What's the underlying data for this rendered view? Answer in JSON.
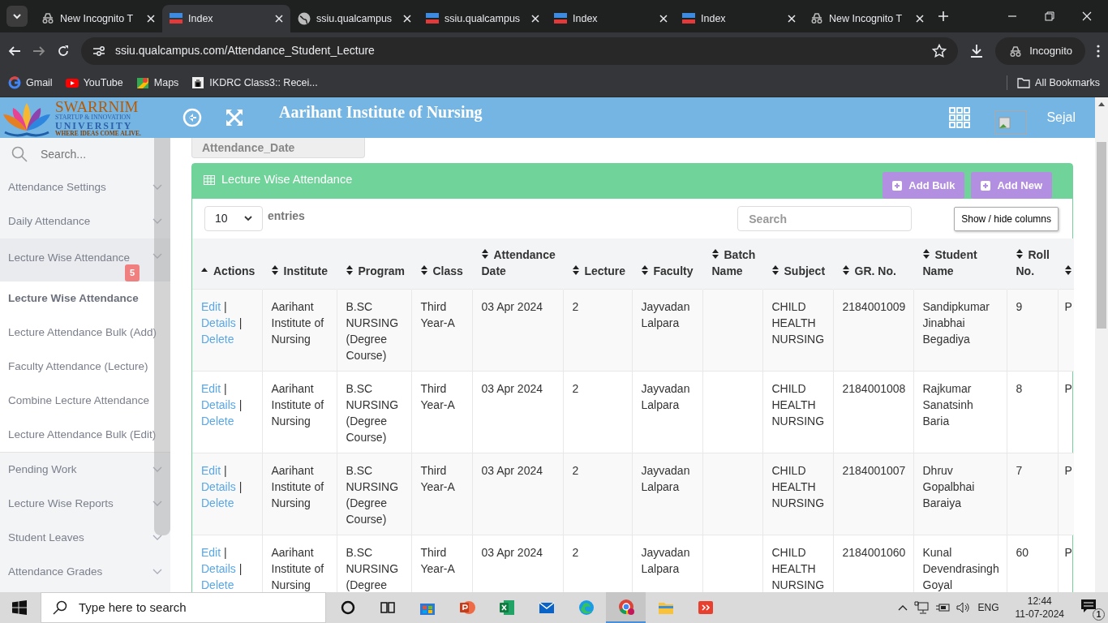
{
  "browser": {
    "tabs": [
      {
        "title": "New Incognito T",
        "kind": "incognito",
        "selected": false
      },
      {
        "title": "Index",
        "kind": "site",
        "selected": true
      },
      {
        "title": "ssiu.qualcampus",
        "kind": "globe",
        "selected": false
      },
      {
        "title": "ssiu.qualcampus",
        "kind": "site",
        "selected": false
      },
      {
        "title": "Index",
        "kind": "site",
        "selected": false
      },
      {
        "title": "Index",
        "kind": "site",
        "selected": false
      },
      {
        "title": "New Incognito T",
        "kind": "incognito",
        "selected": false
      }
    ],
    "url": "ssiu.qualcampus.com/Attendance_Student_Lecture",
    "profile": "Incognito",
    "bookmarks": [
      {
        "label": "Gmail",
        "kind": "google"
      },
      {
        "label": "YouTube",
        "kind": "video"
      },
      {
        "label": "Maps",
        "kind": "map"
      },
      {
        "label": "IKDRC Class3:: Recei...",
        "kind": "emblem"
      }
    ],
    "all_bookmarks": "All Bookmarks"
  },
  "header": {
    "logo": {
      "name": "SWARRNIM",
      "line_2": "STARTUP & INNOVATION",
      "line_3": "UNIVERSITY",
      "tagline": "WHERE IDEAS COME ALIVE."
    },
    "title": "Aarihant Institute of Nursing",
    "user": "Sejal"
  },
  "sidebar": {
    "search_placeholder": "Search...",
    "items": [
      {
        "label": "Attendance Settings",
        "expanded": false
      },
      {
        "label": "Daily Attendance",
        "expanded": false
      },
      {
        "label": "Lecture Wise Attendance",
        "expanded": true,
        "badge": "5",
        "children": [
          {
            "label": "Lecture Wise Attendance",
            "selected": true
          },
          {
            "label": "Lecture Attendance Bulk (Add)",
            "selected": false
          },
          {
            "label": "Faculty Attendance (Lecture)",
            "selected": false
          },
          {
            "label": "Combine Lecture Attendance",
            "selected": false
          },
          {
            "label": "Lecture Attendance Bulk (Edit)",
            "selected": false
          }
        ]
      },
      {
        "label": "Pending Work",
        "expanded": false
      },
      {
        "label": "Lecture Wise Reports",
        "expanded": false
      },
      {
        "label": "Student Leaves",
        "expanded": false
      },
      {
        "label": "Attendance Grades",
        "expanded": false
      }
    ]
  },
  "filter_label": "Attendance_Date",
  "panel": {
    "title": "Lecture Wise Attendance",
    "buttons": [
      "Add Bulk",
      "Add New"
    ],
    "page_size": "10",
    "entries_label": "entries",
    "search_placeholder": "Search",
    "columns_button": "Show / hide columns"
  },
  "table": {
    "columns": [
      {
        "label": "Actions",
        "kind": "sorted"
      },
      {
        "label": "Institute",
        "kind": "sortable"
      },
      {
        "label": "Program",
        "kind": "sortable"
      },
      {
        "label": "Class",
        "kind": "sortable"
      },
      {
        "label": "Attendance Date",
        "kind": "sortable"
      },
      {
        "label": "Lecture",
        "kind": "sortable"
      },
      {
        "label": "Faculty",
        "kind": "sortable"
      },
      {
        "label": "Batch Name",
        "kind": "sortable"
      },
      {
        "label": "Subject",
        "kind": "sortable"
      },
      {
        "label": "GR. No.",
        "kind": "sortable"
      },
      {
        "label": "Student Name",
        "kind": "sortable"
      },
      {
        "label": "Roll No.",
        "kind": "sortable"
      },
      {
        "kind": "sortable"
      }
    ],
    "action_separator": "|",
    "rows": [
      {
        "cells": [
          [
            "Edit",
            "Details",
            "Delete"
          ],
          "Aarihant Institute of Nursing",
          "B.SC NURSING (Degree Course)",
          "Third Year-A",
          "03 Apr 2024",
          "2",
          "Jayvadan Lalpara",
          null,
          "CHILD HEALTH NURSING",
          "2184001009",
          "Sandipkumar Jinabhai Begadiya",
          "9",
          "P"
        ]
      },
      {
        "cells": [
          [
            "Edit",
            "Details",
            "Delete"
          ],
          "Aarihant Institute of Nursing",
          "B.SC NURSING (Degree Course)",
          "Third Year-A",
          "03 Apr 2024",
          "2",
          "Jayvadan Lalpara",
          null,
          "CHILD HEALTH NURSING",
          "2184001008",
          "Rajkumar Sanatsinh Baria",
          "8",
          "P"
        ]
      },
      {
        "cells": [
          [
            "Edit",
            "Details",
            "Delete"
          ],
          "Aarihant Institute of Nursing",
          "B.SC NURSING (Degree Course)",
          "Third Year-A",
          "03 Apr 2024",
          "2",
          "Jayvadan Lalpara",
          null,
          "CHILD HEALTH NURSING",
          "2184001007",
          "Dhruv Gopalbhai Baraiya",
          "7",
          "P"
        ]
      },
      {
        "cells": [
          [
            "Edit",
            "Details",
            "Delete"
          ],
          "Aarihant Institute of Nursing",
          "B.SC NURSING (Degree",
          "Third Year-A",
          "03 Apr 2024",
          "2",
          "Jayvadan Lalpara",
          null,
          "CHILD HEALTH NURSING",
          "2184001060",
          "Kunal Devendrasingh Goyal",
          "60",
          "P"
        ]
      }
    ]
  },
  "taskbar": {
    "search_placeholder": "Type here to search",
    "apps": [
      {
        "kind": "cortana",
        "active": false
      },
      {
        "kind": "taskview",
        "active": false
      },
      {
        "kind": "store",
        "active": false
      },
      {
        "kind": "presentation",
        "active": false
      },
      {
        "kind": "spreadsheet",
        "active": false
      },
      {
        "kind": "mail",
        "active": false
      },
      {
        "kind": "edge",
        "active": false
      },
      {
        "kind": "chrome",
        "active": true
      },
      {
        "kind": "explorer",
        "active": false
      },
      {
        "kind": "remote",
        "active": false
      }
    ],
    "language": "ENG",
    "time": "12:44",
    "date": "11-07-2024",
    "notifications": "1"
  }
}
